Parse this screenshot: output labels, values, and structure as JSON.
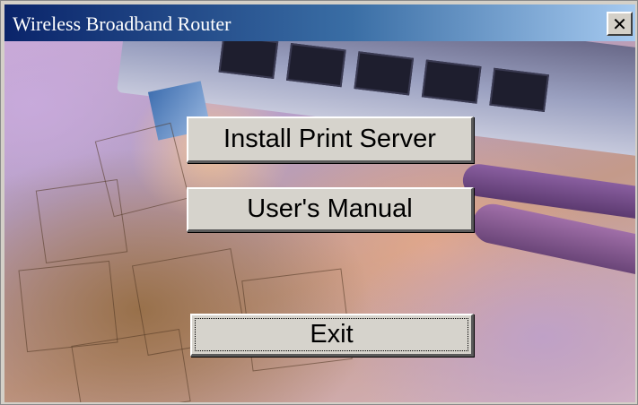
{
  "window": {
    "title": "Wireless Broadband Router",
    "close_label": "✕"
  },
  "buttons": {
    "install_print_server": "Install Print Server",
    "users_manual": "User's Manual",
    "exit": "Exit"
  },
  "colors": {
    "titlebar_start": "#0a246a",
    "titlebar_end": "#a6caf0",
    "button_face": "#d6d3cc"
  },
  "icons": {
    "close": "close-icon"
  }
}
